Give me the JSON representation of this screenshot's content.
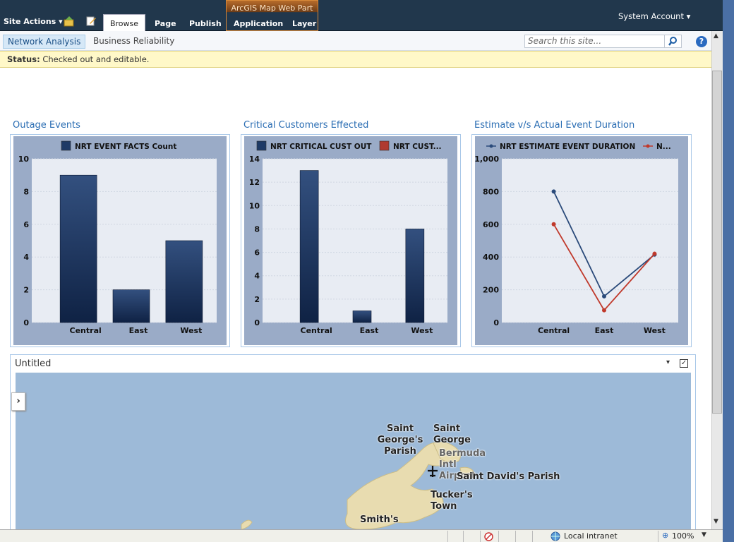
{
  "ribbon": {
    "site_actions": "Site Actions",
    "tabs": [
      "Browse",
      "Page",
      "Publish",
      "Application",
      "Layer"
    ],
    "context_group": "ArcGIS Map Web Part",
    "user": "System Account"
  },
  "subnav": {
    "items": [
      "Network Analysis",
      "Business Reliability"
    ],
    "search_placeholder": "Search this site..."
  },
  "status": {
    "label": "Status:",
    "text": "Checked out and editable."
  },
  "webparts": {
    "outage_title": "Outage Events",
    "critical_title": "Critical Customers Effected",
    "estimate_title": "Estimate v/s Actual Event Duration",
    "untitled_title": "Untitled"
  },
  "chart_data": [
    {
      "type": "bar",
      "categories": [
        "Central",
        "East",
        "West"
      ],
      "series": [
        {
          "name": "NRT EVENT FACTS Count",
          "values": [
            9,
            2,
            5
          ]
        }
      ],
      "ylim": [
        0,
        10
      ],
      "yticks": [
        "0",
        "2",
        "4",
        "6",
        "8",
        "10"
      ],
      "legend": "top",
      "grid": true
    },
    {
      "type": "bar",
      "categories": [
        "Central",
        "East",
        "West"
      ],
      "series": [
        {
          "name": "NRT CRITICAL CUST OUT",
          "values": [
            13,
            1,
            8
          ]
        },
        {
          "name": "NRT CUST...",
          "values": [
            0,
            0,
            0
          ]
        }
      ],
      "ylim": [
        0,
        14
      ],
      "yticks": [
        "0",
        "2",
        "4",
        "6",
        "8",
        "10",
        "12",
        "14"
      ],
      "legend": "top",
      "grid": true
    },
    {
      "type": "line",
      "categories": [
        "Central",
        "East",
        "West"
      ],
      "series": [
        {
          "name": "NRT ESTIMATE EVENT DURATION",
          "values": [
            800,
            160,
            415
          ]
        },
        {
          "name": "N...",
          "values": [
            600,
            75,
            420
          ]
        }
      ],
      "ylim": [
        0,
        1000
      ],
      "yticks": [
        "0",
        "200",
        "400",
        "600",
        "800",
        "1,000"
      ],
      "legend": "top",
      "grid": true
    }
  ],
  "map": {
    "labels": [
      "Saint George's Parish",
      "Saint George",
      "Bermuda Intl Airport",
      "Saint David's Parish",
      "Tucker's Town",
      "Smith's"
    ]
  },
  "ie_status": {
    "zone": "Local intranet",
    "zoom": "100%"
  },
  "colors": {
    "bar": "#1e3a66",
    "line1": "#2a4a7a",
    "line2": "#c0392b",
    "status_bg": "#fff8c8"
  }
}
